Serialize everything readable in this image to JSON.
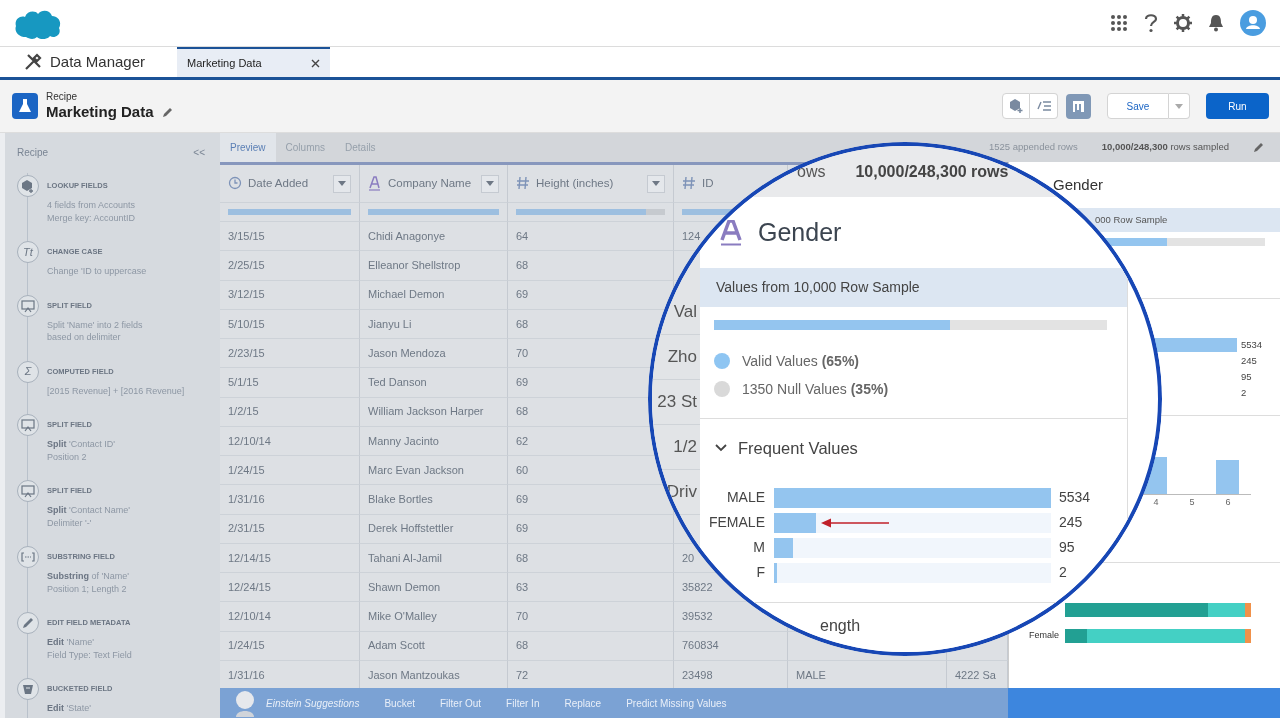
{
  "app": {
    "name": "Data Manager"
  },
  "tabs": [
    {
      "label": "Marketing Data",
      "selected": true
    }
  ],
  "recipe": {
    "type_label": "Recipe",
    "title": "Marketing Data"
  },
  "actions": {
    "save": "Save",
    "run": "Run"
  },
  "sidebar": {
    "title": "Recipe",
    "collapse": "<<",
    "steps": [
      {
        "kind": "lookup",
        "title": "LOOKUP FIELDS",
        "lines": [
          "4 fields from Accounts",
          "Merge key: AccountID"
        ]
      },
      {
        "kind": "case",
        "icon_text": "Tt",
        "title": "CHANGE CASE",
        "lines": [
          "Change 'ID to uppercase"
        ]
      },
      {
        "kind": "split",
        "title": "SPLIT FIELD",
        "lines": [
          "Split 'Name' into 2 fields",
          "based on delimiter"
        ]
      },
      {
        "kind": "computed",
        "icon_text": "Σ",
        "title": "COMPUTED FIELD",
        "lines": [
          "[2015 Revenue] + [2016 Revenue]"
        ]
      },
      {
        "kind": "split",
        "title": "SPLIT FIELD",
        "lines": [
          "**Split** 'Contact ID'",
          "Position 2"
        ]
      },
      {
        "kind": "split",
        "title": "SPLIT FIELD",
        "lines": [
          "**Split** 'Contact Name'",
          "Delimiter '-'"
        ]
      },
      {
        "kind": "substring",
        "title": "SUBSTRING FIELD",
        "lines": [
          "**Substring**  of 'Name'",
          "Position 1; Length 2"
        ]
      },
      {
        "kind": "edit",
        "title": "EDIT FIELD METADATA",
        "lines": [
          "**Edit** 'Name'",
          "Field Type: Text Field"
        ]
      },
      {
        "kind": "bucket",
        "title": "BUCKETED FIELD",
        "lines": [
          "**Edit** 'State'"
        ]
      }
    ]
  },
  "view_tabs": [
    {
      "label": "Preview",
      "selected": true
    },
    {
      "label": "Columns",
      "selected": false
    },
    {
      "label": "Details",
      "selected": false
    }
  ],
  "sample_info": {
    "appended": "1525 appended rows",
    "sampled": "**10,000/248,300** rows sampled"
  },
  "table": {
    "columns": [
      {
        "label": "Date Added",
        "kind": "date",
        "level": 1,
        "has_menu": true
      },
      {
        "label": "Company Name",
        "kind": "text",
        "level": 1,
        "has_menu": true
      },
      {
        "label": "Height (inches)",
        "kind": "number",
        "level": 0.87,
        "has_menu": true
      },
      {
        "label": "ID",
        "kind": "number",
        "level": 1,
        "has_menu": false
      }
    ],
    "rows": [
      {
        "cells": [
          "3/15/15",
          "Chidi Anagonye",
          "64",
          "124"
        ]
      },
      {
        "cells": [
          "2/25/15",
          "Elleanor Shellstrop",
          "68"
        ]
      },
      {
        "cells": [
          "3/12/15",
          "Michael Demon",
          "69"
        ]
      },
      {
        "cells": [
          "5/10/15",
          "Jianyu Li",
          "68"
        ]
      },
      {
        "cells": [
          "2/23/15",
          "Jason Mendoza",
          "70"
        ]
      },
      {
        "cells": [
          "5/1/15",
          "Ted Danson",
          "69"
        ]
      },
      {
        "cells": [
          "1/2/15",
          "William Jackson Harper",
          "68"
        ]
      },
      {
        "cells": [
          "12/10/14",
          "Manny Jacinto",
          "62"
        ]
      },
      {
        "cells": [
          "1/24/15",
          "Marc Evan Jackson",
          "60"
        ]
      },
      {
        "cells": [
          "1/31/16",
          "Blake Bortles",
          "69"
        ]
      },
      {
        "cells": [
          "2/31/15",
          "Derek Hoffstettler",
          "69"
        ]
      },
      {
        "cells": [
          "12/14/15",
          "Tahani Al-Jamil",
          "68",
          "20"
        ]
      },
      {
        "cells": [
          "12/24/15",
          "Shawn Demon",
          "63",
          "35822"
        ]
      },
      {
        "cells": [
          "12/10/14",
          "Mike O'Malley",
          "70",
          "39532"
        ]
      },
      {
        "cells": [
          "1/24/15",
          "Adam Scott",
          "68",
          "760834"
        ]
      },
      {
        "cells": [
          "1/31/16",
          "Jason Mantzoukas",
          "72",
          "23498",
          "MALE",
          "4222 Sa"
        ]
      }
    ]
  },
  "magnifier": {
    "rows_fragment": "ows",
    "rows_count": "10,000/248,300 rows",
    "column_fragments": [
      "Val",
      "Zho",
      "23 St",
      "1/2",
      "Driv"
    ],
    "field": "Gender",
    "sample_label": "Values from 10,000 Row Sample",
    "valid_bar": {
      "level": 0.6
    },
    "legend": [
      {
        "text": "Valid Values **(65%)**",
        "color": "#8ec5f2"
      },
      {
        "text": "1350 Null Values **(35%)**",
        "color": "#d9d9d9"
      }
    ],
    "section": "Frequent Values",
    "expanded": true,
    "frequent_values": [
      {
        "label": "MALE",
        "count": "5534",
        "level": 1
      },
      {
        "label": "FEMALE",
        "count": "245",
        "level": 0.15
      },
      {
        "label": "M",
        "count": "95",
        "level": 0.07
      },
      {
        "label": "F",
        "count": "2",
        "level": 0.01
      }
    ],
    "next_section": "ength"
  },
  "profile_panel": {
    "field": "Gender",
    "sample_label": "000 Row Sample",
    "valid_bar": {
      "level": 0.6
    },
    "frequent_values": [
      {
        "count": "5534",
        "level": 1
      },
      {
        "count": "245"
      },
      {
        "count": "95"
      },
      {
        "count": "2"
      }
    ],
    "histogram": {
      "ticks": [
        "4",
        "5",
        "6"
      ]
    },
    "breakdown": [
      {
        "segments": [
          {
            "color": "#22a093",
            "level": 0.77
          },
          {
            "color": "#44d0c4",
            "level": 0.2
          },
          {
            "color": "#f0914a",
            "level": 0.03
          }
        ]
      },
      {
        "label": "Female",
        "segments": [
          {
            "color": "#22a093",
            "level": 0.12
          },
          {
            "color": "#44d0c4",
            "level": 0.85
          },
          {
            "color": "#f0914a",
            "level": 0.03
          }
        ]
      }
    ]
  },
  "suggestions": {
    "title": "Einstein Suggestions",
    "actions": [
      "Bucket",
      "Filter Out",
      "Filter In",
      "Replace",
      "Predict Missing Values"
    ]
  }
}
